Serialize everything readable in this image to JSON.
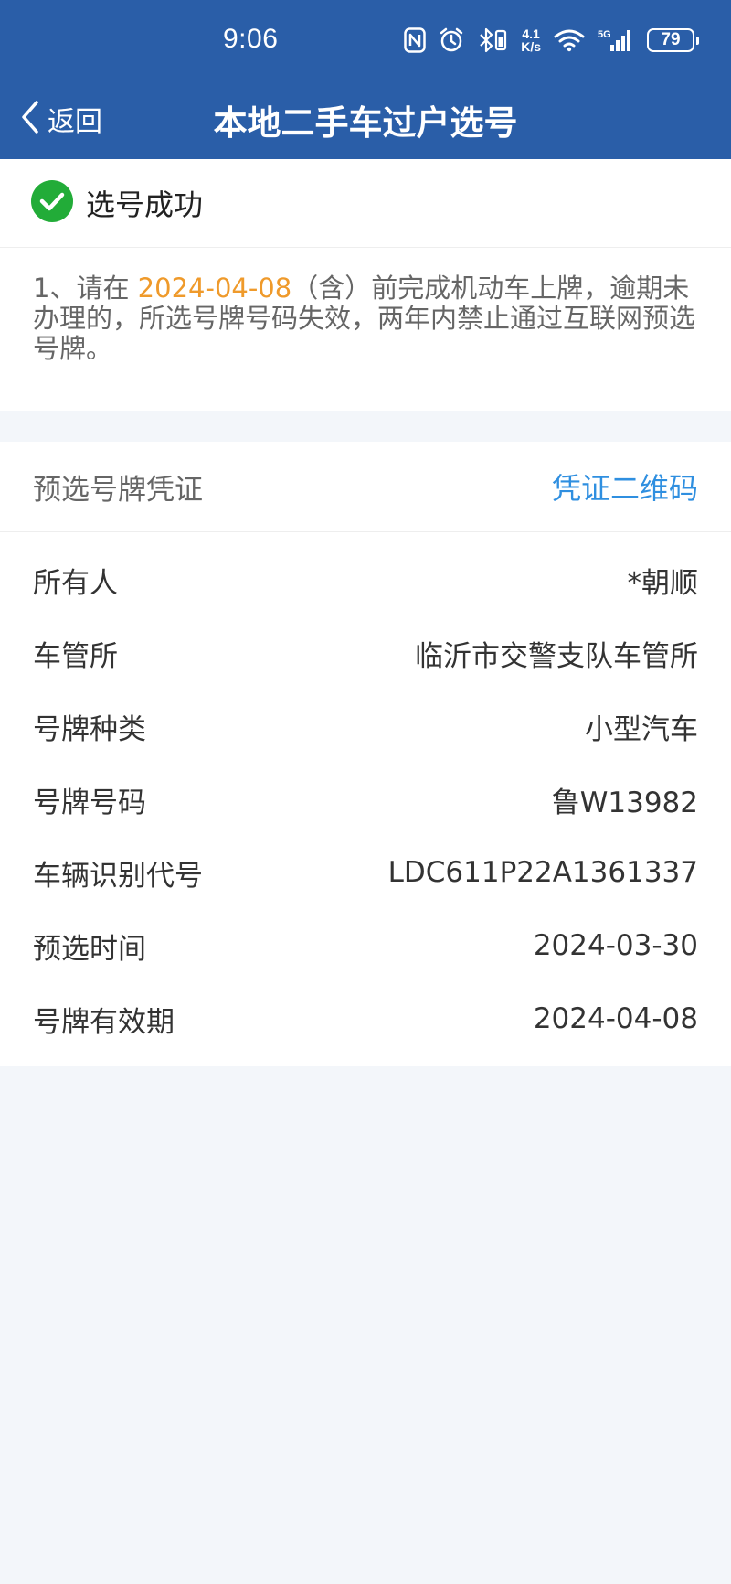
{
  "status_bar": {
    "time": "9:06",
    "net_speed_value": "4.1",
    "net_speed_unit": "K/s",
    "signal_label": "5G",
    "battery": "79"
  },
  "nav": {
    "back_label": "返回",
    "title": "本地二手车过户选号"
  },
  "result": {
    "label": "选号成功"
  },
  "notice": {
    "prefix": "1、请在 ",
    "date": "2024-04-08",
    "suffix": "（含）前完成机动车上牌，逾期未办理的，所选号牌号码失效，两年内禁止通过互联网预选号牌。"
  },
  "voucher": {
    "title": "预选号牌凭证",
    "qr_link": "凭证二维码",
    "rows": [
      {
        "key": "所有人",
        "value": "*朝顺"
      },
      {
        "key": "车管所",
        "value": "临沂市交警支队车管所"
      },
      {
        "key": "号牌种类",
        "value": "小型汽车"
      },
      {
        "key": "号牌号码",
        "value": "鲁W13982"
      },
      {
        "key": "车辆识别代号",
        "value": "LDC611P22A1361337"
      },
      {
        "key": "预选时间",
        "value": "2024-03-30"
      },
      {
        "key": "号牌有效期",
        "value": "2024-04-08"
      }
    ]
  },
  "colors": {
    "header": "#2a5ea8",
    "success": "#22ac38",
    "highlight": "#ef9a2b",
    "link": "#2f8fe0"
  }
}
